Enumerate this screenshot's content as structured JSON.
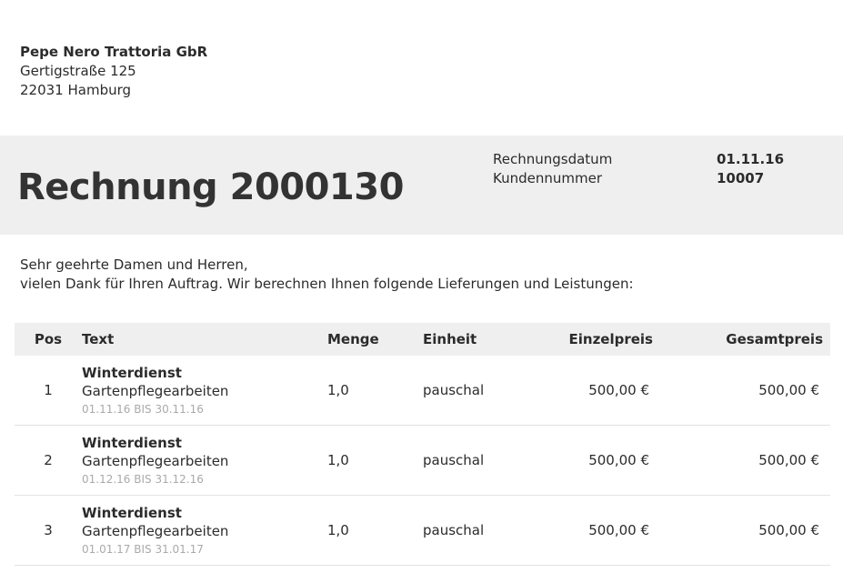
{
  "sender": {
    "name": "Pepe Nero Trattoria GbR",
    "street": "Gertigstraße 125",
    "city": "22031 Hamburg"
  },
  "invoice": {
    "title": "Rechnung 2000130",
    "date_label": "Rechnungsdatum",
    "date_value": "01.11.16",
    "customer_label": "Kundennummer",
    "customer_value": "10007"
  },
  "greeting": {
    "line1": "Sehr geehrte Damen und Herren,",
    "line2": "vielen Dank für Ihren Auftrag. Wir berechnen Ihnen folgende Lieferungen und Leistungen:"
  },
  "table": {
    "headers": [
      "Pos",
      "Text",
      "Menge",
      "Einheit",
      "Einzelpreis",
      "Gesamtpreis"
    ],
    "rows": [
      {
        "pos": "1",
        "title": "Winterdienst",
        "desc": "Gartenpflegearbeiten",
        "period": "01.11.16 BIS 30.11.16",
        "menge": "1,0",
        "einheit": "pauschal",
        "einzelpreis": "500,00 €",
        "gesamtpreis": "500,00 €"
      },
      {
        "pos": "2",
        "title": "Winterdienst",
        "desc": "Gartenpflegearbeiten",
        "period": "01.12.16 BIS 31.12.16",
        "menge": "1,0",
        "einheit": "pauschal",
        "einzelpreis": "500,00 €",
        "gesamtpreis": "500,00 €"
      },
      {
        "pos": "3",
        "title": "Winterdienst",
        "desc": "Gartenpflegearbeiten",
        "period": "01.01.17 BIS 31.01.17",
        "menge": "1,0",
        "einheit": "pauschal",
        "einzelpreis": "500,00 €",
        "gesamtpreis": "500,00 €"
      }
    ]
  }
}
